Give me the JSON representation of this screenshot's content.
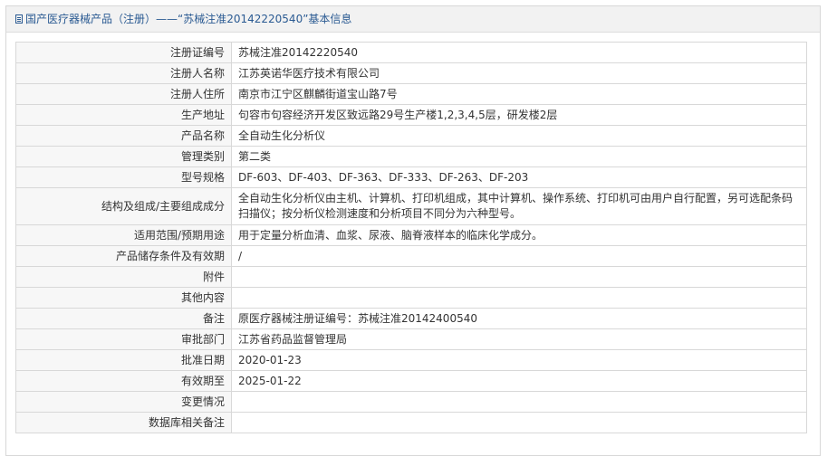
{
  "header": {
    "title": "国产医疗器械产品（注册）——“苏械注准20142220540”基本信息"
  },
  "rows": [
    {
      "label": "注册证编号",
      "value": "苏械注准20142220540"
    },
    {
      "label": "注册人名称",
      "value": "江苏英诺华医疗技术有限公司"
    },
    {
      "label": "注册人住所",
      "value": "南京市江宁区麒麟街道宝山路7号"
    },
    {
      "label": "生产地址",
      "value": "句容市句容经济开发区致远路29号生产楼1,2,3,4,5层，研发楼2层"
    },
    {
      "label": "产品名称",
      "value": "全自动生化分析仪"
    },
    {
      "label": "管理类别",
      "value": "第二类"
    },
    {
      "label": "型号规格",
      "value": "DF-603、DF-403、DF-363、DF-333、DF-263、DF-203"
    },
    {
      "label": "结构及组成/主要组成成分",
      "value": "全自动生化分析仪由主机、计算机、打印机组成，其中计算机、操作系统、打印机可由用户自行配置，另可选配条码扫描仪；按分析仪检测速度和分析项目不同分为六种型号。"
    },
    {
      "label": "适用范围/预期用途",
      "value": "用于定量分析血清、血浆、尿液、脑脊液样本的临床化学成分。"
    },
    {
      "label": "产品储存条件及有效期",
      "value": "/"
    },
    {
      "label": "附件",
      "value": ""
    },
    {
      "label": "其他内容",
      "value": ""
    },
    {
      "label": "备注",
      "value": "原医疗器械注册证编号：苏械注准20142400540"
    },
    {
      "label": "审批部门",
      "value": "江苏省药品监督管理局"
    },
    {
      "label": "批准日期",
      "value": "2020-01-23"
    },
    {
      "label": "有效期至",
      "value": "2025-01-22"
    },
    {
      "label": "变更情况",
      "value": ""
    },
    {
      "label": "数据库相关备注",
      "value": ""
    }
  ]
}
